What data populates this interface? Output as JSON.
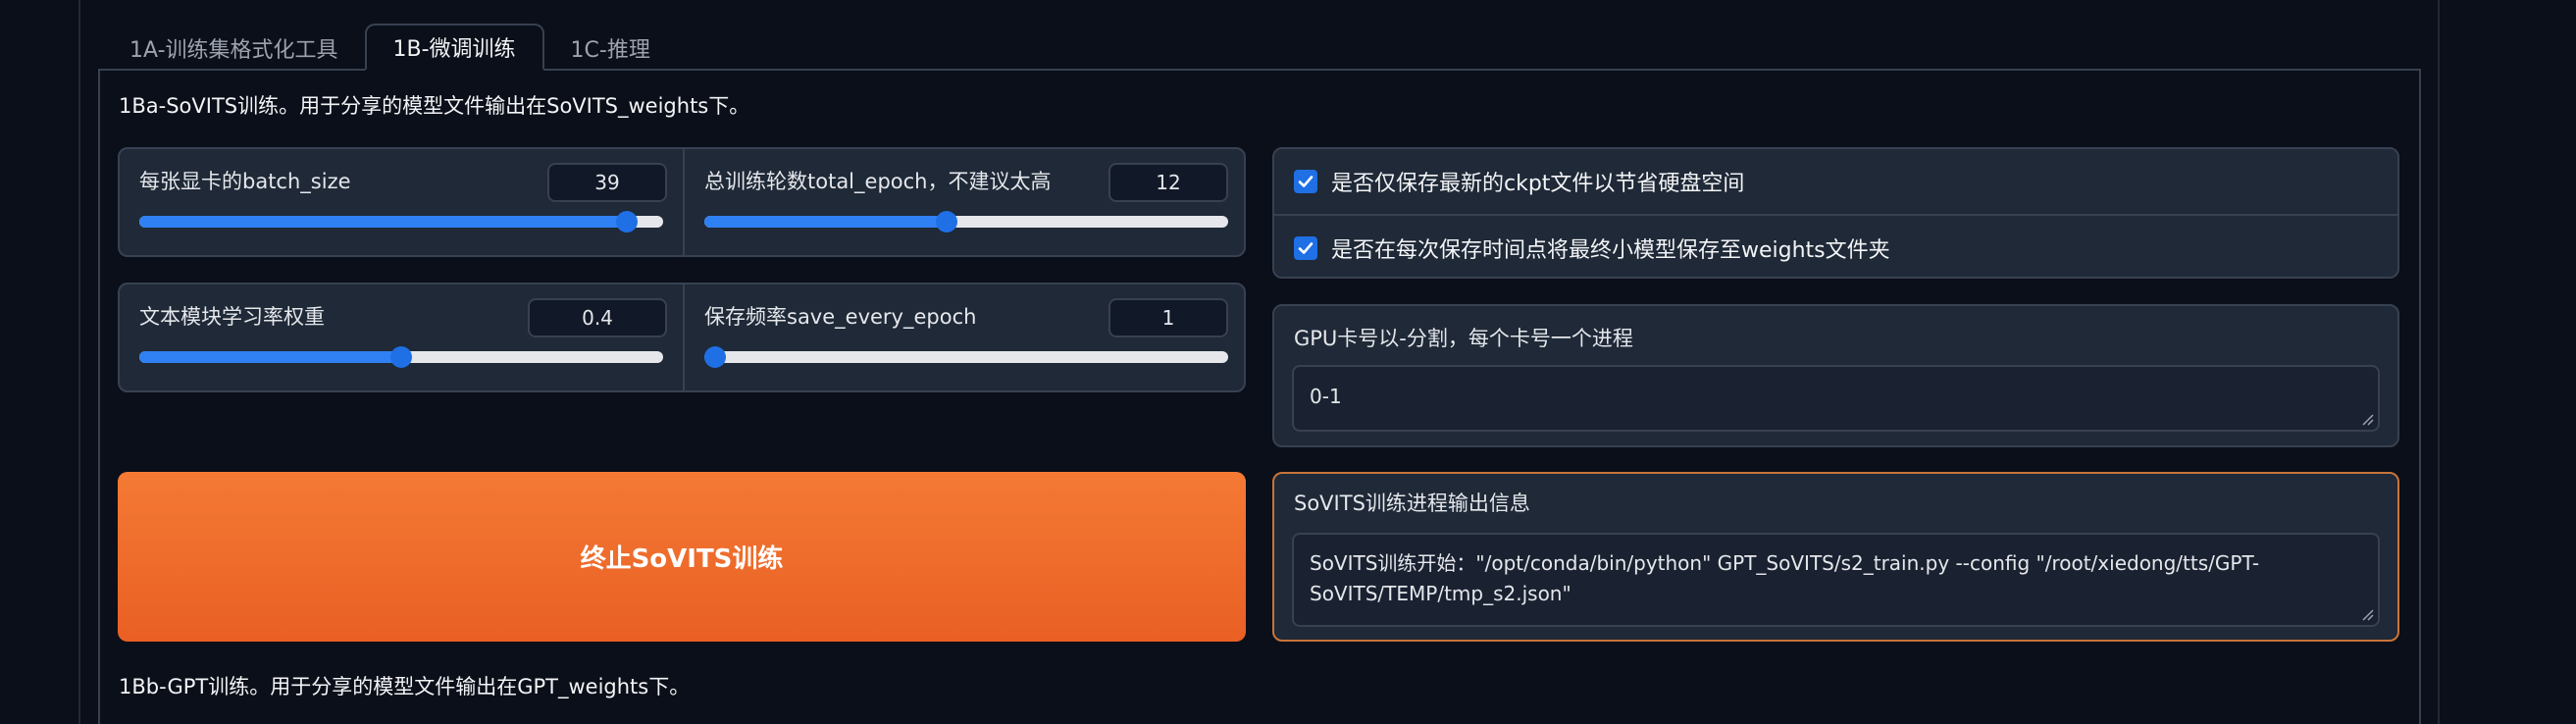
{
  "tabs": [
    {
      "label": "1A-训练集格式化工具"
    },
    {
      "label": "1B-微调训练"
    },
    {
      "label": "1C-推理"
    }
  ],
  "sovits_section": {
    "title": "1Ba-SoVITS训练。用于分享的模型文件输出在SoVITS_weights下。"
  },
  "sliders": {
    "batch_size": {
      "label": "每张显卡的batch_size",
      "value": "39",
      "fraction": 0.95
    },
    "total_epoch": {
      "label": "总训练轮数total_epoch，不建议太高",
      "value": "12",
      "fraction": 0.46
    },
    "text_lr_weight": {
      "label": "文本模块学习率权重",
      "value": "0.4",
      "fraction": 0.5
    },
    "save_every_epoch": {
      "label": "保存频率save_every_epoch",
      "value": "1",
      "fraction": 0.0
    }
  },
  "checkboxes": {
    "save_latest_only": {
      "label": "是否仅保存最新的ckpt文件以节省硬盘空间",
      "checked": true
    },
    "save_every_weights": {
      "label": "是否在每次保存时间点将最终小模型保存至weights文件夹",
      "checked": true
    }
  },
  "gpu_field": {
    "label": "GPU卡号以-分割，每个卡号一个进程",
    "value": "0-1"
  },
  "stop_button": {
    "label": "终止SoVITS训练"
  },
  "output": {
    "label": "SoVITS训练进程输出信息",
    "value": "SoVITS训练开始：\"/opt/conda/bin/python\" GPT_SoVITS/s2_train.py --config \"/root/xiedong/tts/GPT-SoVITS/TEMP/tmp_s2.json\""
  },
  "gpt_section": {
    "title": "1Bb-GPT训练。用于分享的模型文件输出在GPT_weights下。"
  },
  "colors": {
    "accent_blue": "#1f6fe5",
    "button_orange": "#f47a34",
    "output_border": "#c8743a"
  }
}
